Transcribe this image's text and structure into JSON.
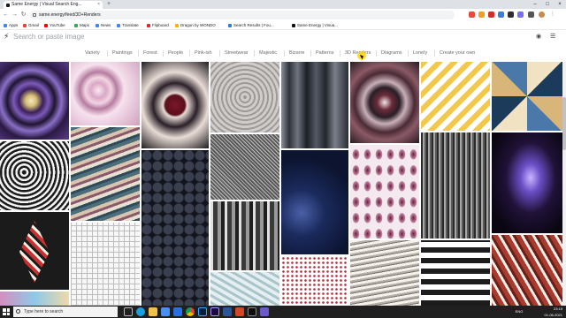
{
  "browser": {
    "tab_title": "Same Energy | Visual Search Eng...",
    "tab_close": "×",
    "new_tab": "+",
    "url": "same.energy/feed/3D+Renders",
    "back": "←",
    "forward": "→",
    "reload": "↻",
    "window_min": "–",
    "window_max": "□",
    "window_close": "×",
    "bookmarks": [
      {
        "label": "Apps",
        "color": "#4285f4"
      },
      {
        "label": "Gmail",
        "color": "#ea4335"
      },
      {
        "label": "YouTube",
        "color": "#ff0000"
      },
      {
        "label": "Maps",
        "color": "#34a853"
      },
      {
        "label": "News",
        "color": "#4285f4"
      },
      {
        "label": "Translate",
        "color": "#4285f4"
      },
      {
        "label": "Flipboard",
        "color": "#e12828"
      },
      {
        "label": "Dragon by WONDO",
        "color": "#f4b400"
      },
      {
        "label": "Search Results | Fou...",
        "color": "#2f7bd9"
      },
      {
        "label": "Same Energy | Visua...",
        "color": "#111111"
      }
    ]
  },
  "app": {
    "logo_glyph": "⚡",
    "search_placeholder": "Search or paste image",
    "icons": {
      "camera": "camera-icon",
      "menu": "hamburger-icon"
    },
    "camera_glyph": "◉",
    "menu_glyph": "☰",
    "categories": [
      "Variety",
      "Paintings",
      "Forest",
      "People",
      "Pink-ish",
      "Streetwear",
      "Majestic",
      "Bizarre",
      "Patterns",
      "3D Renders",
      "Diagrams",
      "Lonely",
      "Create your own"
    ],
    "selected_category": "3D Renders"
  },
  "taskbar": {
    "search_placeholder": "Type here to search",
    "time": "23:15",
    "date": "01-06-2021",
    "lang": "ENG",
    "apps": [
      "task-view",
      "edge",
      "file-explorer",
      "store",
      "mail",
      "chrome",
      "photoshop",
      "premiere",
      "word",
      "powerpoint",
      "terminal",
      "media"
    ]
  }
}
